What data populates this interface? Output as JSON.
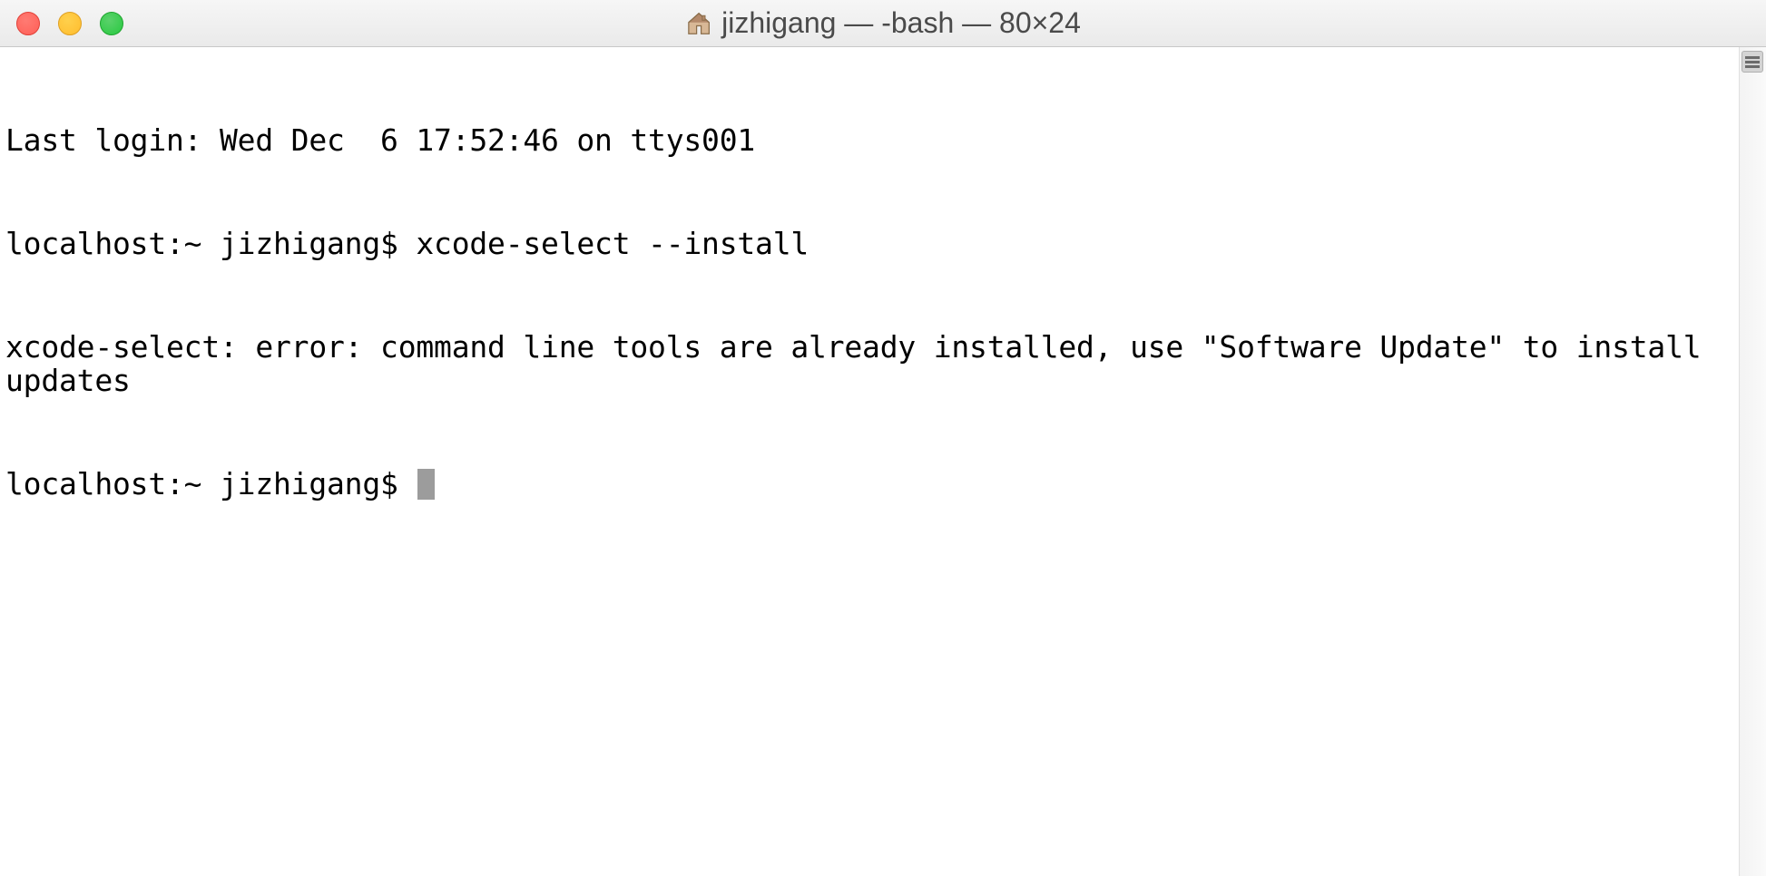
{
  "titlebar": {
    "home_icon": "home-icon",
    "title": "jizhigang — -bash — 80×24"
  },
  "terminal": {
    "last_login": "Last login: Wed Dec  6 17:52:46 on ttys001",
    "prompt1": "localhost:~ jizhigang$ ",
    "command1": "xcode-select --install",
    "output1": "xcode-select: error: command line tools are already installed, use \"Software Update\" to install updates",
    "prompt2": "localhost:~ jizhigang$ "
  }
}
